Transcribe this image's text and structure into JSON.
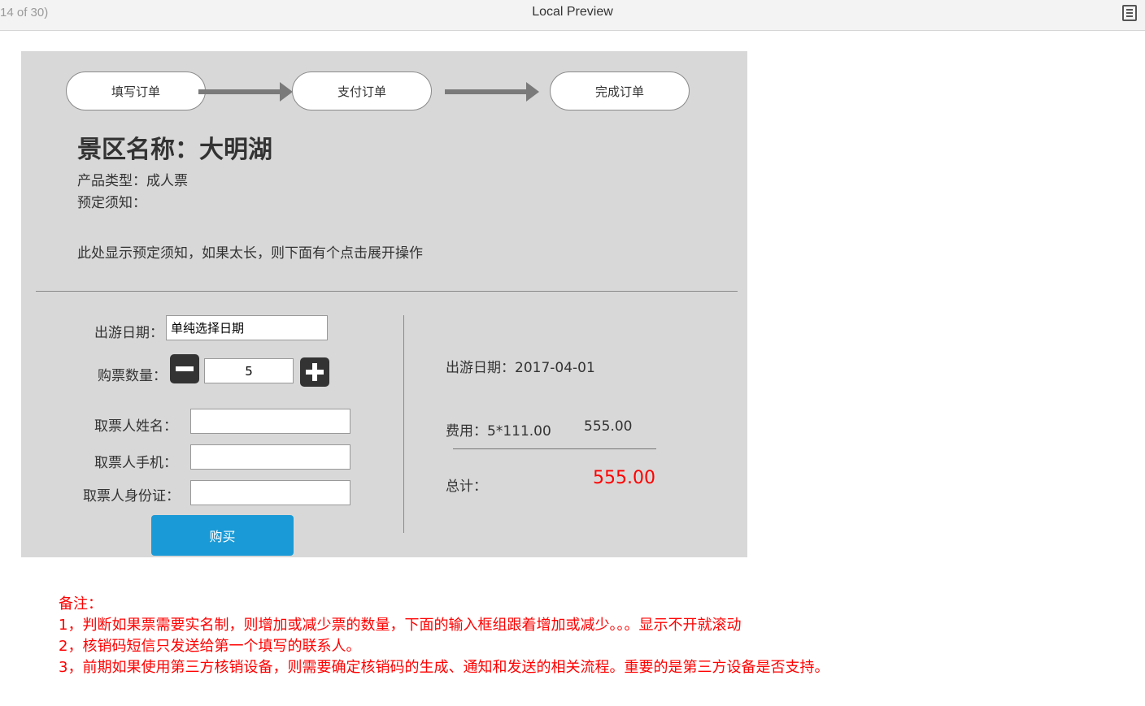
{
  "topbar": {
    "page_counter": "14 of 30)",
    "title": "Local Preview"
  },
  "steps": [
    "填写订单",
    "支付订单",
    "完成订单"
  ],
  "scenic": {
    "title": "景区名称：大明湖",
    "product_type": "产品类型：成人票",
    "notice_label": "预定须知：",
    "notice_text": "此处显示预定须知，如果太长，则下面有个点击展开操作"
  },
  "form": {
    "date_label": "出游日期：",
    "date_value": "单纯选择日期",
    "qty_label": "购票数量：",
    "qty_value": "5",
    "name_label": "取票人姓名：",
    "phone_label": "取票人手机：",
    "id_label": "取票人身份证：",
    "buy_label": "购买"
  },
  "summary": {
    "date_line": "出游日期：2017-04-01",
    "fee_label": "费用：5*111.00",
    "fee_amount": "555.00",
    "total_label": "总计：",
    "total_amount": "555.00"
  },
  "notes": {
    "title": "备注：",
    "items": [
      "1，判断如果票需要实名制，则增加或减少票的数量，下面的输入框组跟着增加或减少。。。显示不开就滚动",
      "2，核销码短信只发送给第一个填写的联系人。",
      "3，前期如果使用第三方核销设备，则需要确定核销码的生成、通知和发送的相关流程。重要的是第三方设备是否支持。"
    ]
  },
  "colors": {
    "panel_bg": "#d8d8d8",
    "buy_button": "#1a9ad6",
    "total_amount": "#ff0000",
    "notes_text": "#ff0000"
  },
  "icons": {
    "minus": "minus-icon",
    "plus": "plus-icon",
    "menu": "menu-list-icon"
  }
}
